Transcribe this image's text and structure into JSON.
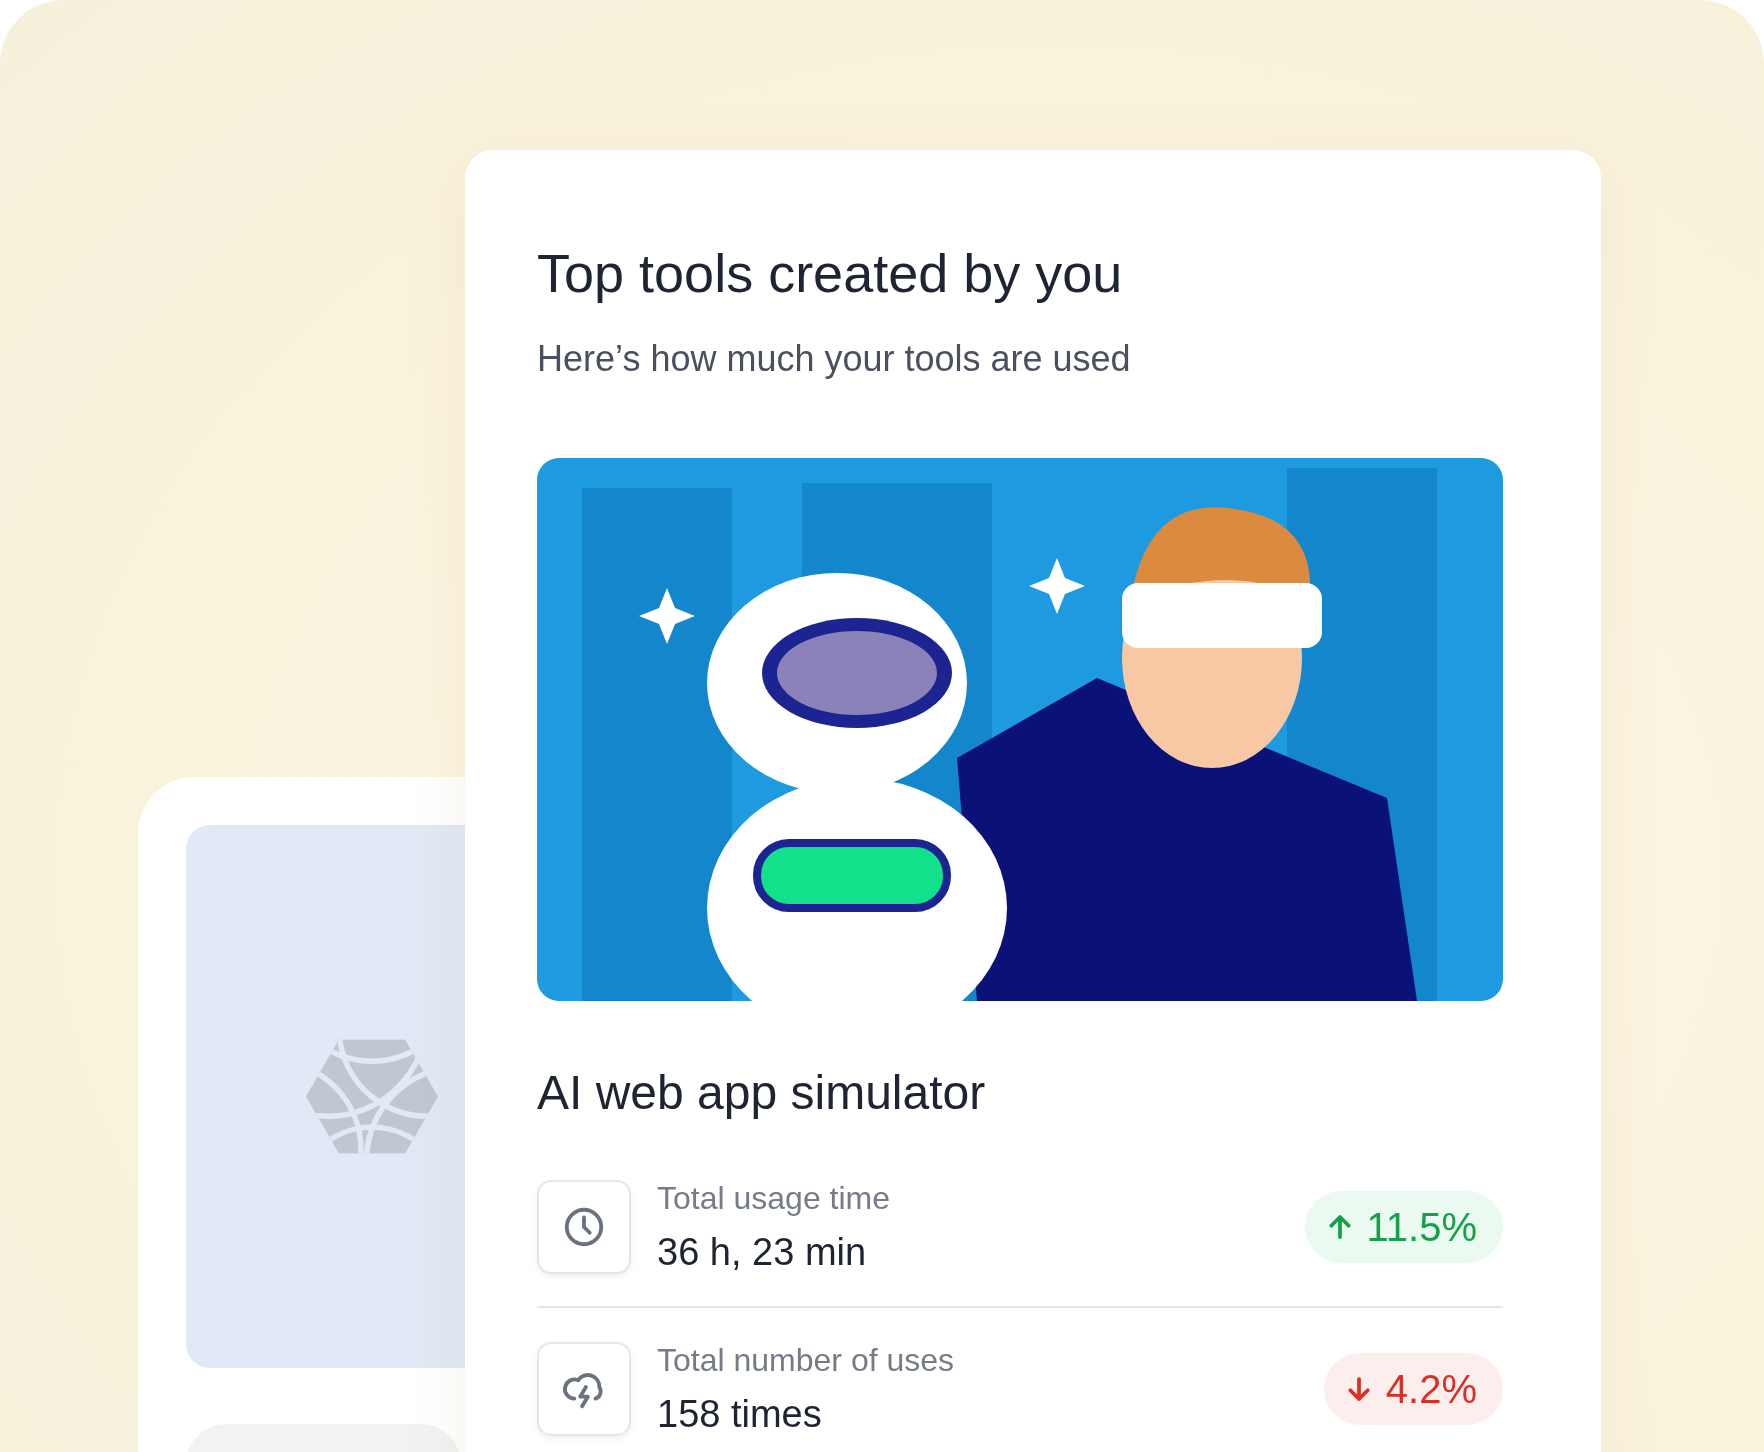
{
  "title": "Top tools created by you",
  "subtitle": "Here’s how much your tools are used",
  "tool_name": "AI web app simulator",
  "stats": [
    {
      "kind": "time",
      "label": "Total usage time",
      "value": "36 h, 23 min",
      "change": "11.5%",
      "rising": true
    },
    {
      "kind": "uses",
      "label": "Total number of uses",
      "value": "158 times",
      "change": "4.2%",
      "rising": false
    }
  ]
}
